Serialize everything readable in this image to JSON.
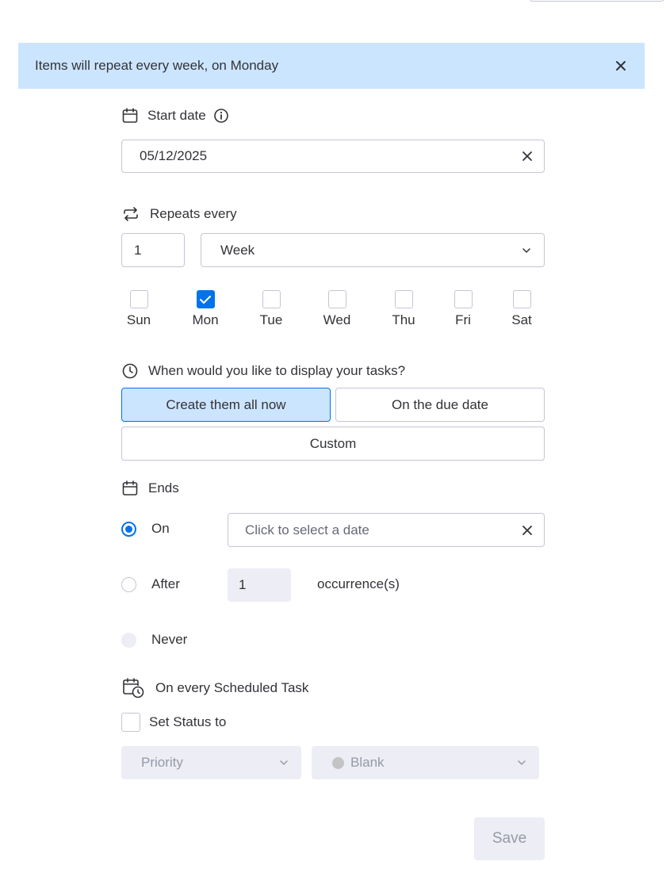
{
  "banner": {
    "text": "Items will repeat every week, on Monday"
  },
  "start_date": {
    "label": "Start date",
    "value": "05/12/2025"
  },
  "repeats": {
    "label": "Repeats every",
    "interval": "1",
    "unit": "Week"
  },
  "days": [
    {
      "label": "Sun",
      "checked": false
    },
    {
      "label": "Mon",
      "checked": true
    },
    {
      "label": "Tue",
      "checked": false
    },
    {
      "label": "Wed",
      "checked": false
    },
    {
      "label": "Thu",
      "checked": false
    },
    {
      "label": "Fri",
      "checked": false
    },
    {
      "label": "Sat",
      "checked": false
    }
  ],
  "display": {
    "label": "When would you like to display your tasks?",
    "options": [
      "Create them all now",
      "On the due date",
      "Custom"
    ],
    "selected": "Create them all now"
  },
  "ends": {
    "label": "Ends",
    "on_label": "On",
    "date_placeholder": "Click to select a date",
    "after_label": "After",
    "after_count": "1",
    "occurrence_label": "occurrence(s)",
    "never_label": "Never",
    "selected": "On"
  },
  "scheduled": {
    "label": "On every Scheduled Task",
    "set_status_label": "Set Status to",
    "column_placeholder": "Priority",
    "status_value": "Blank"
  },
  "footer": {
    "save_label": "Save"
  },
  "colors": {
    "primary": "#0073ea",
    "selected_bg": "#cce5ff",
    "disabled_bg": "#ecedf5",
    "border": "#c3c6d4"
  }
}
